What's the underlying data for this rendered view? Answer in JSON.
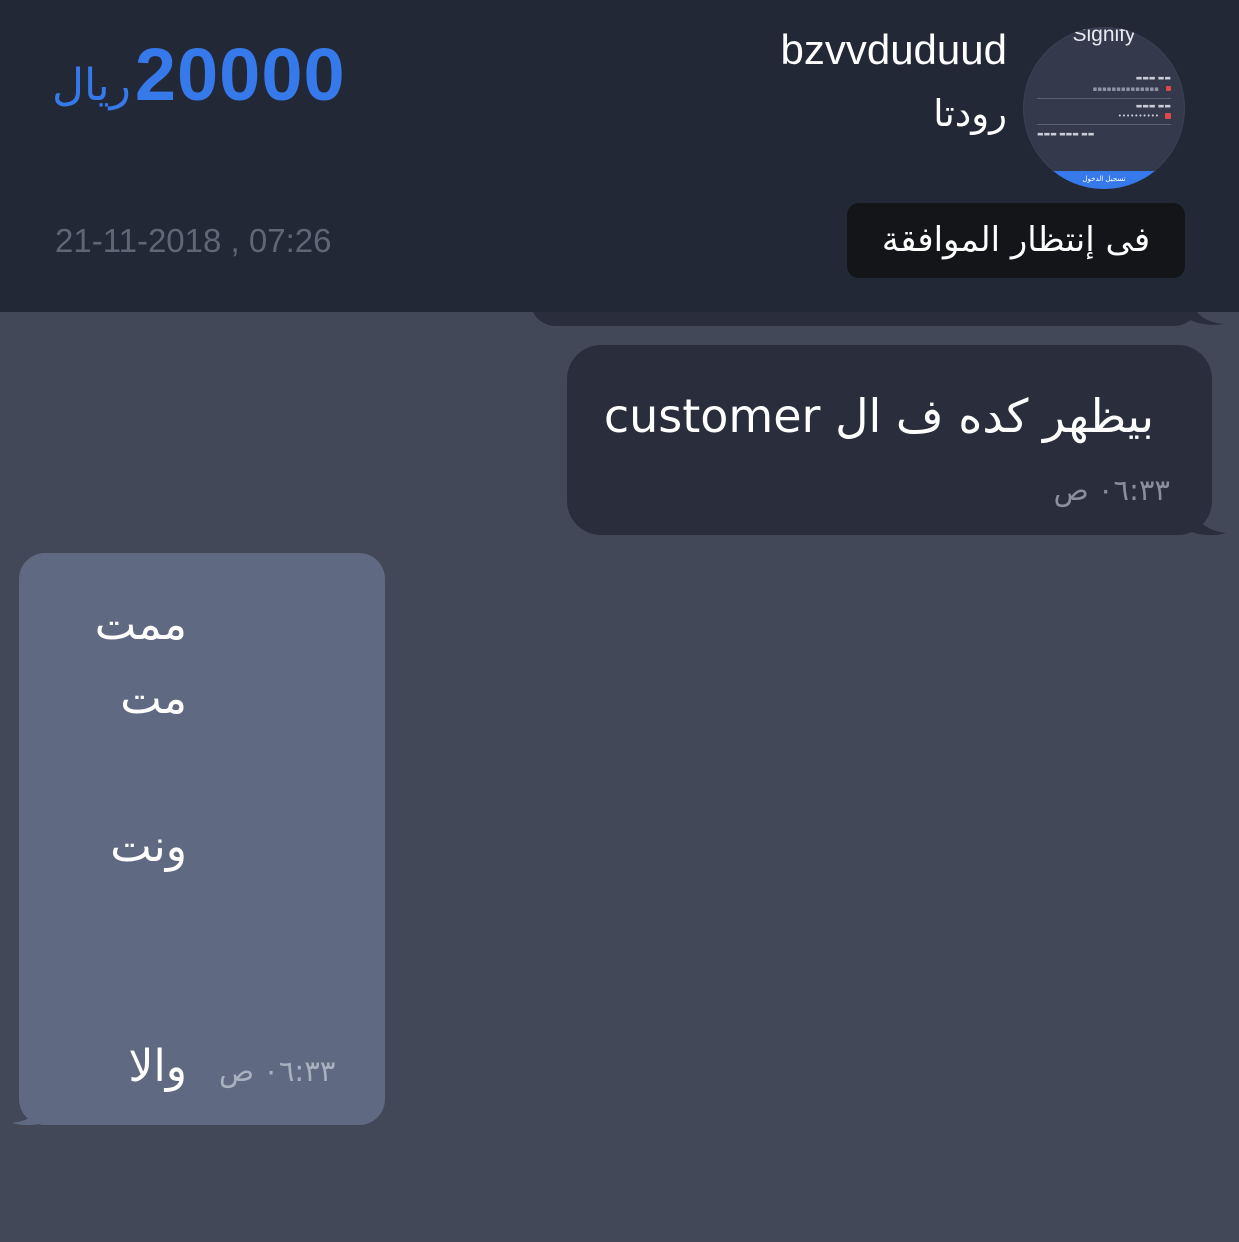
{
  "header": {
    "price_amount": "20000",
    "price_currency": "ريال",
    "timestamp": "21-11-2018 , 07:26",
    "username": "bzvvduduud",
    "subtitle": "رودتا",
    "status_badge": "فى إنتظار الموافقة",
    "avatar": {
      "app_name": "Signify",
      "login_button": "تسجيل الدخول"
    }
  },
  "messages": [
    {
      "direction": "outgoing",
      "text": "بيظهر كده ف ال customer",
      "time": "٠٦:٣٣ ص"
    },
    {
      "direction": "incoming",
      "lines": [
        "ممت",
        "مت",
        "ونت",
        "والا"
      ],
      "time": "٠٦:٣٣ ص"
    }
  ],
  "colors": {
    "background": "#424857",
    "header": "#232836",
    "accent": "#3579ea",
    "outgoing_bubble": "#2a2e3c",
    "incoming_bubble": "#5f6a82",
    "badge": "#131519"
  }
}
